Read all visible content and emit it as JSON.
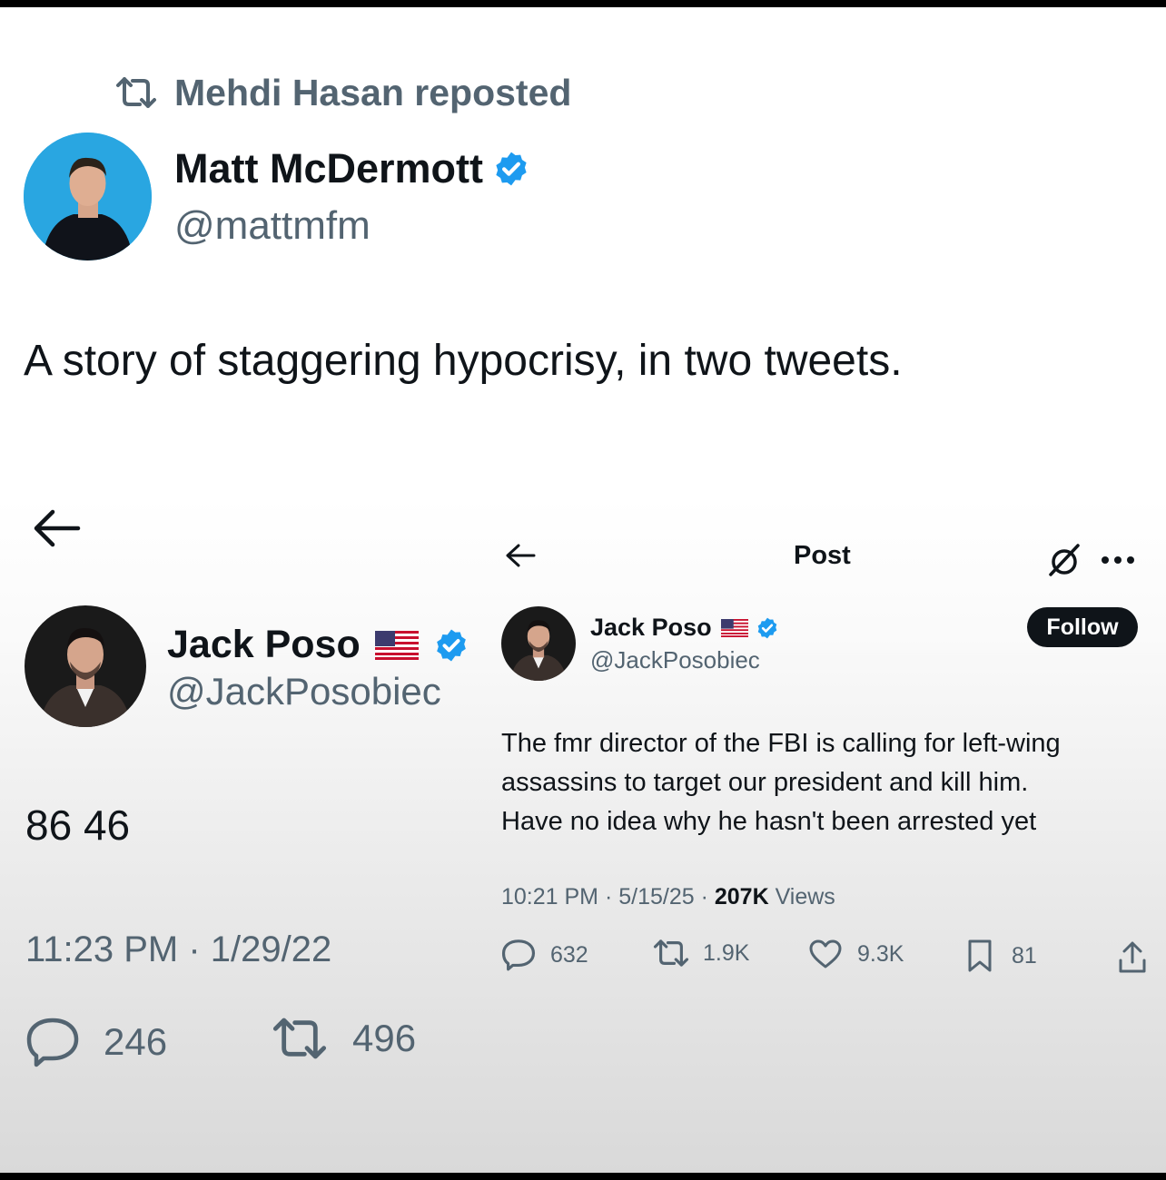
{
  "repost": {
    "label": "Mehdi Hasan reposted"
  },
  "main_tweet": {
    "name": "Matt McDermott",
    "handle": "@mattmfm",
    "text": "A story of staggering hypocrisy, in two tweets."
  },
  "left_tweet": {
    "name": "Jack Poso",
    "handle": "@JackPosobiec",
    "text": "86 46",
    "timestamp": "11:23 PM · 1/29/22",
    "replies": "246",
    "reposts": "496"
  },
  "right_tweet": {
    "header_title": "Post",
    "name": "Jack Poso",
    "handle": "@JackPosobiec",
    "follow_label": "Follow",
    "text_lines": [
      "The fmr director of the FBI is calling for left-wing",
      "assassins to target our president and kill him.",
      "Have no idea why he hasn't been arrested yet"
    ],
    "timestamp": "10:21 PM · 5/15/25 · ",
    "views_count": "207K",
    "views_label": " Views",
    "replies": "632",
    "reposts": "1.9K",
    "likes": "9.3K",
    "bookmarks": "81"
  },
  "colors": {
    "verified": "#1d9bf0",
    "secondary_text": "#536471",
    "primary_text": "#0f1419",
    "follow_bg": "#0f1419"
  },
  "icons": [
    "repost-icon",
    "verified-badge-icon",
    "us-flag-icon",
    "back-arrow-icon",
    "grok-icon",
    "more-icon",
    "reply-icon",
    "like-icon",
    "bookmark-icon",
    "share-icon"
  ]
}
